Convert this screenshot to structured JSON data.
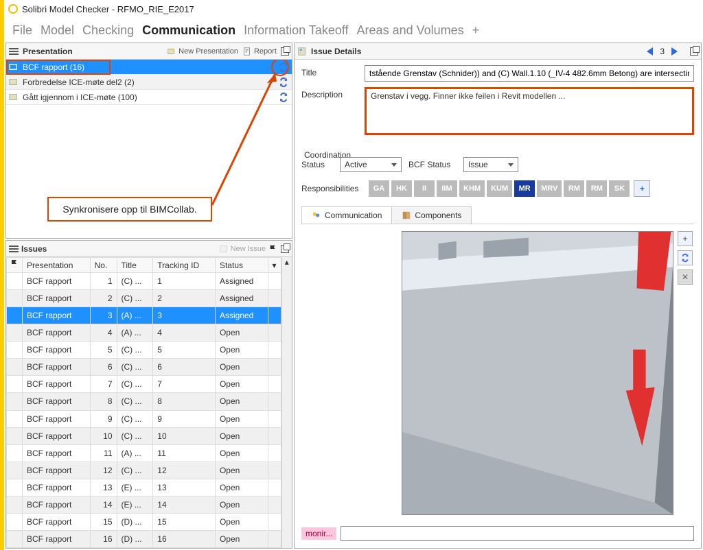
{
  "window": {
    "title": "Solibri Model Checker - RFMO_RIE_E2017"
  },
  "menu": {
    "items": [
      "File",
      "Model",
      "Checking",
      "Communication",
      "Information Takeoff",
      "Areas and Volumes"
    ],
    "active": "Communication",
    "plus": "+"
  },
  "presentation": {
    "title": "Presentation",
    "new_btn": "New Presentation",
    "report_btn": "Report",
    "rows": [
      {
        "label": "BCF rapport (16)",
        "selected": true,
        "sync": true
      },
      {
        "label": "Forbredelse ICE-møte del2 (2)",
        "selected": false,
        "sync": true
      },
      {
        "label": "Gått igjennom i ICE-møte (100)",
        "selected": false,
        "sync": true
      }
    ],
    "annotation": "Synkronisere opp til BIMCollab."
  },
  "issues": {
    "title": "Issues",
    "new_btn": "New Issue",
    "cols": [
      "Presentation",
      "No.",
      "Title",
      "Tracking ID",
      "Status"
    ],
    "rows": [
      {
        "p": "BCF rapport",
        "n": "1",
        "t": "(C) ...",
        "id": "1",
        "s": "Assigned",
        "alt": false,
        "sel": false
      },
      {
        "p": "BCF rapport",
        "n": "2",
        "t": "(C) ...",
        "id": "2",
        "s": "Assigned",
        "alt": true,
        "sel": false
      },
      {
        "p": "BCF rapport",
        "n": "3",
        "t": "(A) ...",
        "id": "3",
        "s": "Assigned",
        "alt": false,
        "sel": true
      },
      {
        "p": "BCF rapport",
        "n": "4",
        "t": "(A) ...",
        "id": "4",
        "s": "Open",
        "alt": true,
        "sel": false
      },
      {
        "p": "BCF rapport",
        "n": "5",
        "t": "(C) ...",
        "id": "5",
        "s": "Open",
        "alt": false,
        "sel": false
      },
      {
        "p": "BCF rapport",
        "n": "6",
        "t": "(C) ...",
        "id": "6",
        "s": "Open",
        "alt": true,
        "sel": false
      },
      {
        "p": "BCF rapport",
        "n": "7",
        "t": "(C) ...",
        "id": "7",
        "s": "Open",
        "alt": false,
        "sel": false
      },
      {
        "p": "BCF rapport",
        "n": "8",
        "t": "(C) ...",
        "id": "8",
        "s": "Open",
        "alt": true,
        "sel": false
      },
      {
        "p": "BCF rapport",
        "n": "9",
        "t": "(C) ...",
        "id": "9",
        "s": "Open",
        "alt": false,
        "sel": false
      },
      {
        "p": "BCF rapport",
        "n": "10",
        "t": "(C) ...",
        "id": "10",
        "s": "Open",
        "alt": true,
        "sel": false
      },
      {
        "p": "BCF rapport",
        "n": "11",
        "t": "(A) ...",
        "id": "11",
        "s": "Open",
        "alt": false,
        "sel": false
      },
      {
        "p": "BCF rapport",
        "n": "12",
        "t": "(C) ...",
        "id": "12",
        "s": "Open",
        "alt": true,
        "sel": false
      },
      {
        "p": "BCF rapport",
        "n": "13",
        "t": "(E) ...",
        "id": "13",
        "s": "Open",
        "alt": false,
        "sel": false
      },
      {
        "p": "BCF rapport",
        "n": "14",
        "t": "(E) ...",
        "id": "14",
        "s": "Open",
        "alt": true,
        "sel": false
      },
      {
        "p": "BCF rapport",
        "n": "15",
        "t": "(D) ...",
        "id": "15",
        "s": "Open",
        "alt": false,
        "sel": false
      },
      {
        "p": "BCF rapport",
        "n": "16",
        "t": "(D) ...",
        "id": "16",
        "s": "Open",
        "alt": true,
        "sel": false
      }
    ]
  },
  "details": {
    "panel_title": "Issue Details",
    "nav_page": "3",
    "title_label": "Title",
    "title_value": "tstående Grenstav (Schnider)) and (C) Wall.1.10 (_IV-4 482.6mm Betong) are intersectin",
    "desc_label": "Description",
    "desc_value": "Grenstav i vegg. Finner ikke feilen i Revit modellen ...",
    "coord_label": "Coordination",
    "status_label": "Status",
    "status_value": "Active",
    "bcf_status_label": "BCF Status",
    "bcf_status_value": "Issue",
    "resp_label": "Responsibilities",
    "resp_tags": [
      {
        "code": "GA",
        "active": false
      },
      {
        "code": "HK",
        "active": false
      },
      {
        "code": "II",
        "active": false
      },
      {
        "code": "IIM",
        "active": false
      },
      {
        "code": "KHM",
        "active": false
      },
      {
        "code": "KUM",
        "active": false
      },
      {
        "code": "MR",
        "active": true
      },
      {
        "code": "MRV",
        "active": false
      },
      {
        "code": "RM",
        "active": false
      },
      {
        "code": "RM",
        "active": false
      },
      {
        "code": "SK",
        "active": false
      }
    ],
    "tabs": [
      {
        "label": "Communication",
        "active": true
      },
      {
        "label": "Components",
        "active": false
      }
    ],
    "comment_user": "monir...",
    "add": "+"
  }
}
